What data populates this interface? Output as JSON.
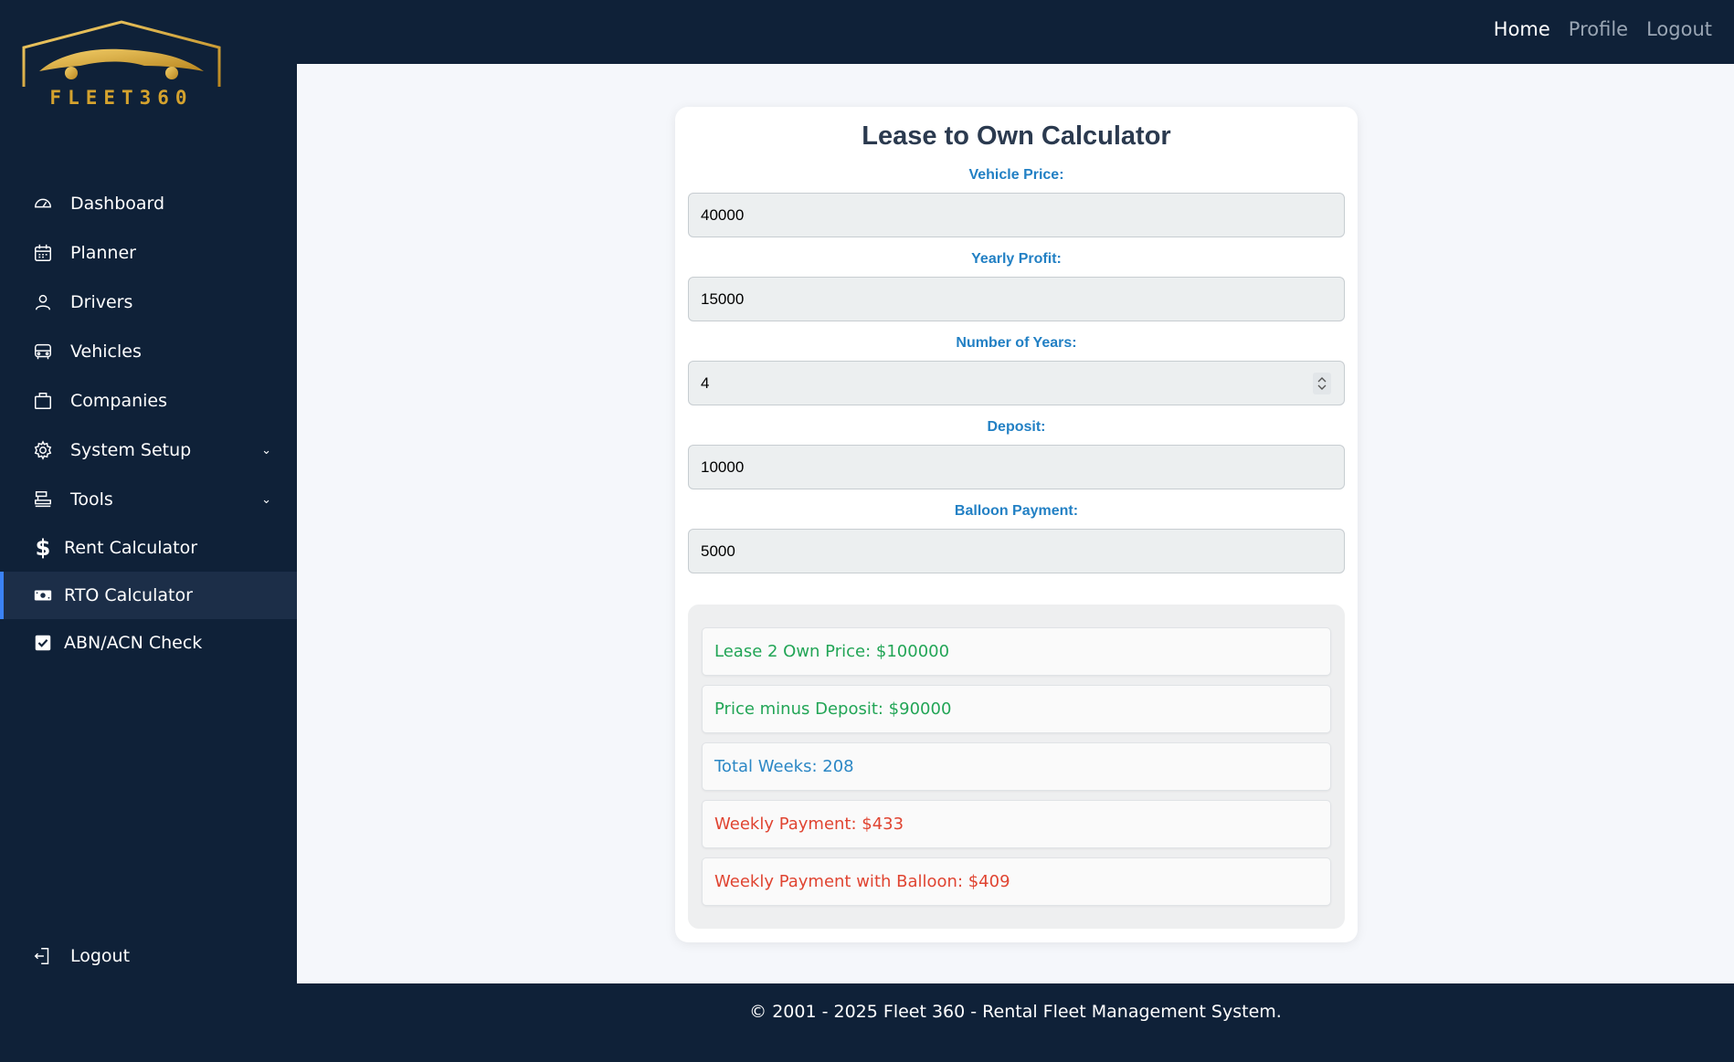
{
  "topnav": {
    "home": "Home",
    "profile": "Profile",
    "logout": "Logout"
  },
  "brand": {
    "name": "FLEET360",
    "accent": "#d4a22e"
  },
  "sidebar": {
    "items": [
      {
        "label": "Dashboard",
        "icon": "speedometer-icon"
      },
      {
        "label": "Planner",
        "icon": "calendar-icon"
      },
      {
        "label": "Drivers",
        "icon": "user-icon"
      },
      {
        "label": "Vehicles",
        "icon": "car-icon"
      },
      {
        "label": "Companies",
        "icon": "briefcase-icon"
      },
      {
        "label": "System Setup",
        "icon": "gear-icon"
      },
      {
        "label": "Tools",
        "icon": "tools-icon"
      },
      {
        "label": "Rent Calculator",
        "icon": "dollar-icon"
      },
      {
        "label": "RTO Calculator",
        "icon": "cash-icon"
      },
      {
        "label": "ABN/ACN Check",
        "icon": "checkbox-icon"
      }
    ],
    "logout": "Logout"
  },
  "calculator": {
    "title": "Lease to Own Calculator",
    "fields": [
      {
        "label": "Vehicle Price:",
        "value": "40000"
      },
      {
        "label": "Yearly Profit:",
        "value": "15000"
      },
      {
        "label": "Number of Years:",
        "value": "4"
      },
      {
        "label": "Deposit:",
        "value": "10000"
      },
      {
        "label": "Balloon Payment:",
        "value": "5000"
      }
    ],
    "results": [
      "Lease 2 Own Price: $100000",
      "Price minus Deposit: $90000",
      "Total Weeks: 208",
      "Weekly Payment: $433",
      "Weekly Payment with Balloon: $409"
    ]
  },
  "footer": "© 2001 - 2025 Fleet 360 - Rental Fleet Management System."
}
